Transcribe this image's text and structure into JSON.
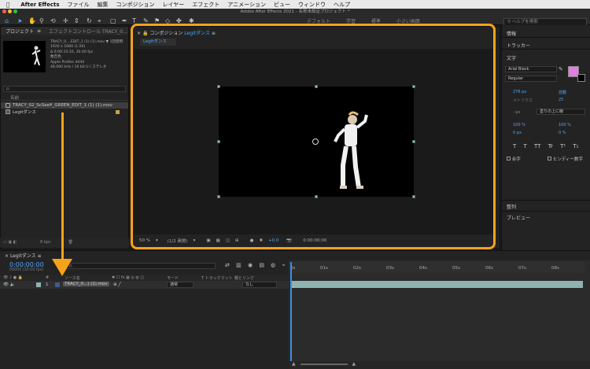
{
  "menubar": {
    "app": "After Effects",
    "items": [
      "ファイル",
      "編集",
      "コンポジション",
      "レイヤー",
      "エフェクト",
      "アニメーション",
      "ビュー",
      "ウィンドウ",
      "ヘルプ"
    ]
  },
  "window_title": "Adobe After Effects 2021 - 名称未設定プロジェクト *",
  "toolbar": {
    "workspaces": [
      "デフォルト",
      "学習",
      "標準",
      "小さい画面"
    ],
    "help_search_placeholder": "ヘルプを検索"
  },
  "project_panel": {
    "tab": "プロジェクト",
    "effect_tab": "エフェクトコントロール TRACY_0...",
    "selected_file": "TRACY_0....EDIT_1 (1) (1).mov ▼",
    "usage": "1回使用",
    "meta_lines": [
      "1920 x 1080 (1.00)",
      "Δ 0:00:15:10, 30.00 fps",
      "数百色",
      "Apple ProRes 4444",
      "48.000 kHz / 16 bit U / ステレオ"
    ],
    "search_placeholder": "ρ,",
    "col_name": "名前",
    "items": [
      {
        "name": "TRACY_02_ScSee¥_GREEN_EDIT_1 (1) (1).mov",
        "selected": true
      },
      {
        "name": "Legitダンス",
        "selected": false
      }
    ],
    "footer": "8 bpc"
  },
  "comp_panel": {
    "tab_prefix": "コンポジション",
    "tab_name": "Legitダンス",
    "subtab": "Legitダンス",
    "zoom": "50 %",
    "resolution": "(1/2 画質)",
    "exposure": "+0.0",
    "timecode": "0:00:00:00"
  },
  "right_panel": {
    "sections": [
      "情報",
      "トラッカー",
      "文字"
    ],
    "font": "Arial Black",
    "style": "Regular",
    "size": "276 px",
    "leading": "自動",
    "kerning": "メトリクス",
    "tracking": "25",
    "stroke": "- px",
    "stroke_type": "塗りの上に線",
    "vscale": "100 %",
    "hscale": "100 %",
    "baseline": "0 px",
    "tsume": "0 %",
    "type_buttons": [
      "T",
      "T",
      "TT",
      "Tr",
      "T¹",
      "T₁"
    ],
    "ligature": "合字",
    "hindi": "ヒンディー数字",
    "lower_sections": [
      "整列",
      "プレビュー"
    ],
    "fill_color": "#e07fe0"
  },
  "timeline": {
    "tab": "Legitダンス",
    "timecode": "0:00:00:00",
    "fps": "00000 (30.00 fps)",
    "search_placeholder": "ρ,",
    "ruler_ticks": [
      "0s",
      "01s",
      "02s",
      "03s",
      "04s",
      "05s",
      "06s",
      "07s",
      "08s"
    ],
    "headers": {
      "num": "#",
      "name": "ソース名",
      "mode": "モード",
      "track": "T トラックマット",
      "parent": "親とリンク"
    },
    "layer": {
      "num": "1",
      "name": "TRACY_0...) (1).mov",
      "mode": "通常",
      "parent": "なし"
    }
  },
  "annotation_color": "#f7a21b"
}
